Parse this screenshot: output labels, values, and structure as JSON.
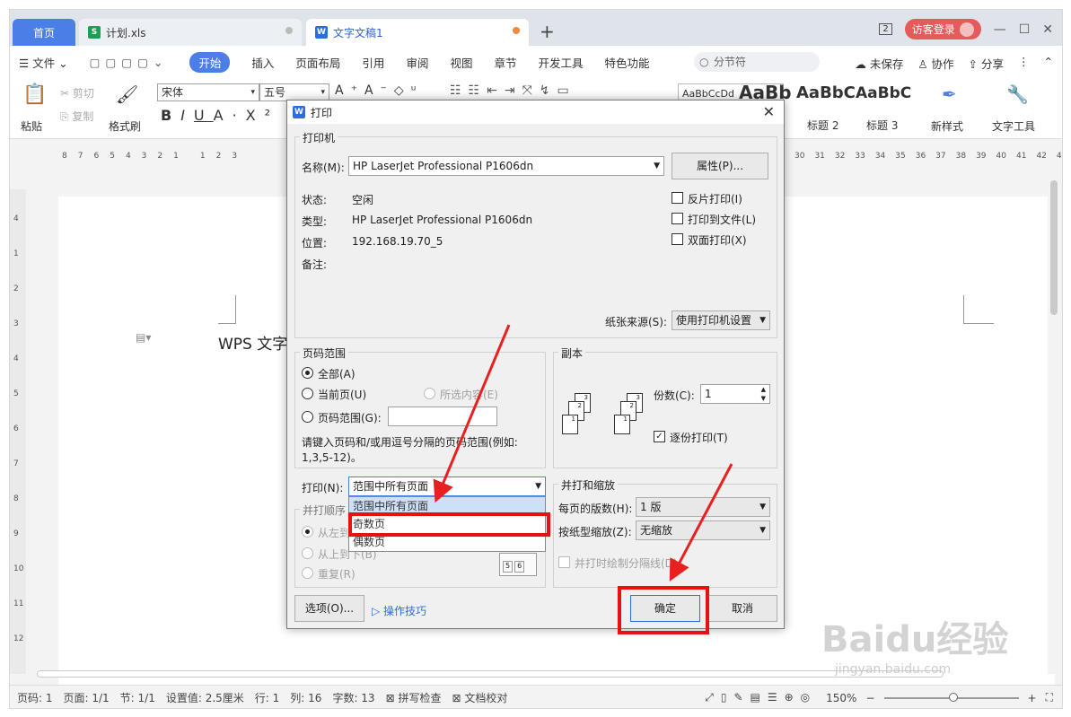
{
  "tabs": {
    "home": "首页",
    "xls": "计划.xls",
    "doc": "文字文稿1"
  },
  "window": {
    "login": "访客登录",
    "min": "—",
    "max": "☐",
    "close": "✕",
    "badge": "2"
  },
  "menu": {
    "file": "文件",
    "items": [
      "开始",
      "插入",
      "页面布局",
      "引用",
      "审阅",
      "视图",
      "章节",
      "开发工具",
      "特色功能"
    ],
    "search": "分节符",
    "unsaved": "未保存",
    "collab": "协作",
    "share": "分享"
  },
  "ribbon": {
    "paste": "粘贴",
    "cut": "剪切",
    "copy": "复制",
    "format_painter": "格式刷",
    "font": "宋体",
    "size": "五号",
    "styles": [
      "AaBbCcDd",
      "AaBb",
      "AaBbC",
      "AaBbC"
    ],
    "style_labels": [
      "标题 2",
      "标题 3"
    ],
    "new_style": "新样式",
    "text_tools": "文字工具"
  },
  "ruler": {
    "left_ticks": [
      "8",
      "7",
      "6",
      "5",
      "4",
      "3",
      "2",
      "1",
      "",
      "1",
      "2",
      "3"
    ],
    "right_ticks": [
      "30",
      "31",
      "32",
      "33",
      "34",
      "35",
      "36",
      "37",
      "38",
      "39",
      "40",
      "41",
      "42",
      "43",
      "44"
    ],
    "vticks": [
      "4",
      "1",
      "2",
      "3",
      "4",
      "5",
      "6",
      "7",
      "8",
      "9",
      "10",
      "11",
      "12"
    ]
  },
  "document": {
    "text": "WPS 文字"
  },
  "status": {
    "page_num": "页码: 1",
    "pages": "页面: 1/1",
    "section": "节: 1/1",
    "setting": "设置值: 2.5厘米",
    "row": "行: 1",
    "col": "列: 16",
    "words": "字数: 13",
    "spell": "拼写检查",
    "proof": "文档校对",
    "zoom": "150%"
  },
  "dialog": {
    "title": "打印",
    "printer_group": "打印机",
    "name_label": "名称(M):",
    "printer_name": "HP LaserJet Professional P1606dn",
    "properties": "属性(P)...",
    "status_label": "状态:",
    "status_value": "空闲",
    "type_label": "类型:",
    "type_value": "HP LaserJet Professional P1606dn",
    "location_label": "位置:",
    "location_value": "192.168.19.70_5",
    "comment_label": "备注:",
    "reverse": "反片打印(I)",
    "to_file": "打印到文件(L)",
    "duplex": "双面打印(X)",
    "paper_source_label": "纸张来源(S):",
    "paper_source": "使用打印机设置",
    "range_group": "页码范围",
    "all": "全部(A)",
    "current": "当前页(U)",
    "selection": "所选内容(E)",
    "page_range": "页码范围(G):",
    "range_hint": "请键入页码和/或用逗号分隔的页码范围(例如:",
    "range_hint2": "1,3,5-12)。",
    "copies_group": "副本",
    "copies_label": "份数(C):",
    "copies_value": "1",
    "collate": "逐份打印(T)",
    "print_label": "打印(N):",
    "print_value": "范围中所有页面",
    "print_options": [
      "范围中所有页面",
      "奇数页",
      "偶数页"
    ],
    "order_group": "并打顺序",
    "order_lr": "从左到右",
    "order_tb": "从上到下(B)",
    "order_repeat": "重复(R)",
    "scale_group": "并打和缩放",
    "per_page_label": "每页的版数(H):",
    "per_page": "1 版",
    "scale_label": "按纸型缩放(Z):",
    "scale": "无缩放",
    "draw_sep": "并打时绘制分隔线(D)",
    "options": "选项(O)...",
    "tips": "操作技巧",
    "ok": "确定",
    "cancel": "取消"
  },
  "watermark": {
    "logo": "Baidu经验",
    "url": "jingyan.baidu.com"
  }
}
